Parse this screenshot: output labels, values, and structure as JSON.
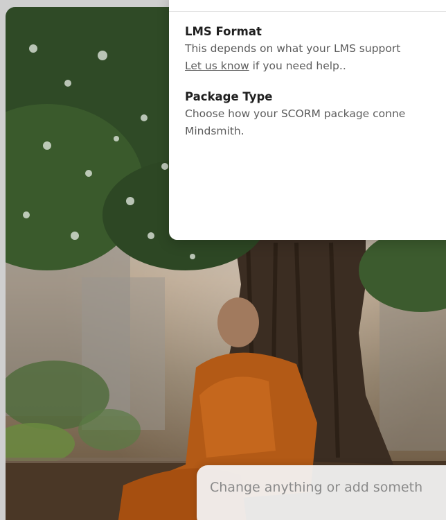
{
  "popover": {
    "sections": [
      {
        "title": "LMS Format",
        "line1": "This depends on what your LMS support",
        "link": "Let us know",
        "line2_rest": " if you need help.."
      },
      {
        "title": "Package Type",
        "line1": "Choose how your SCORM package conne",
        "line2": "Mindsmith."
      }
    ]
  },
  "prompt": {
    "placeholder": "Change anything or add someth"
  },
  "colors": {
    "card_bg": "#ffffff",
    "title_text": "#1f1f1f",
    "body_text": "#5c5c5c"
  }
}
